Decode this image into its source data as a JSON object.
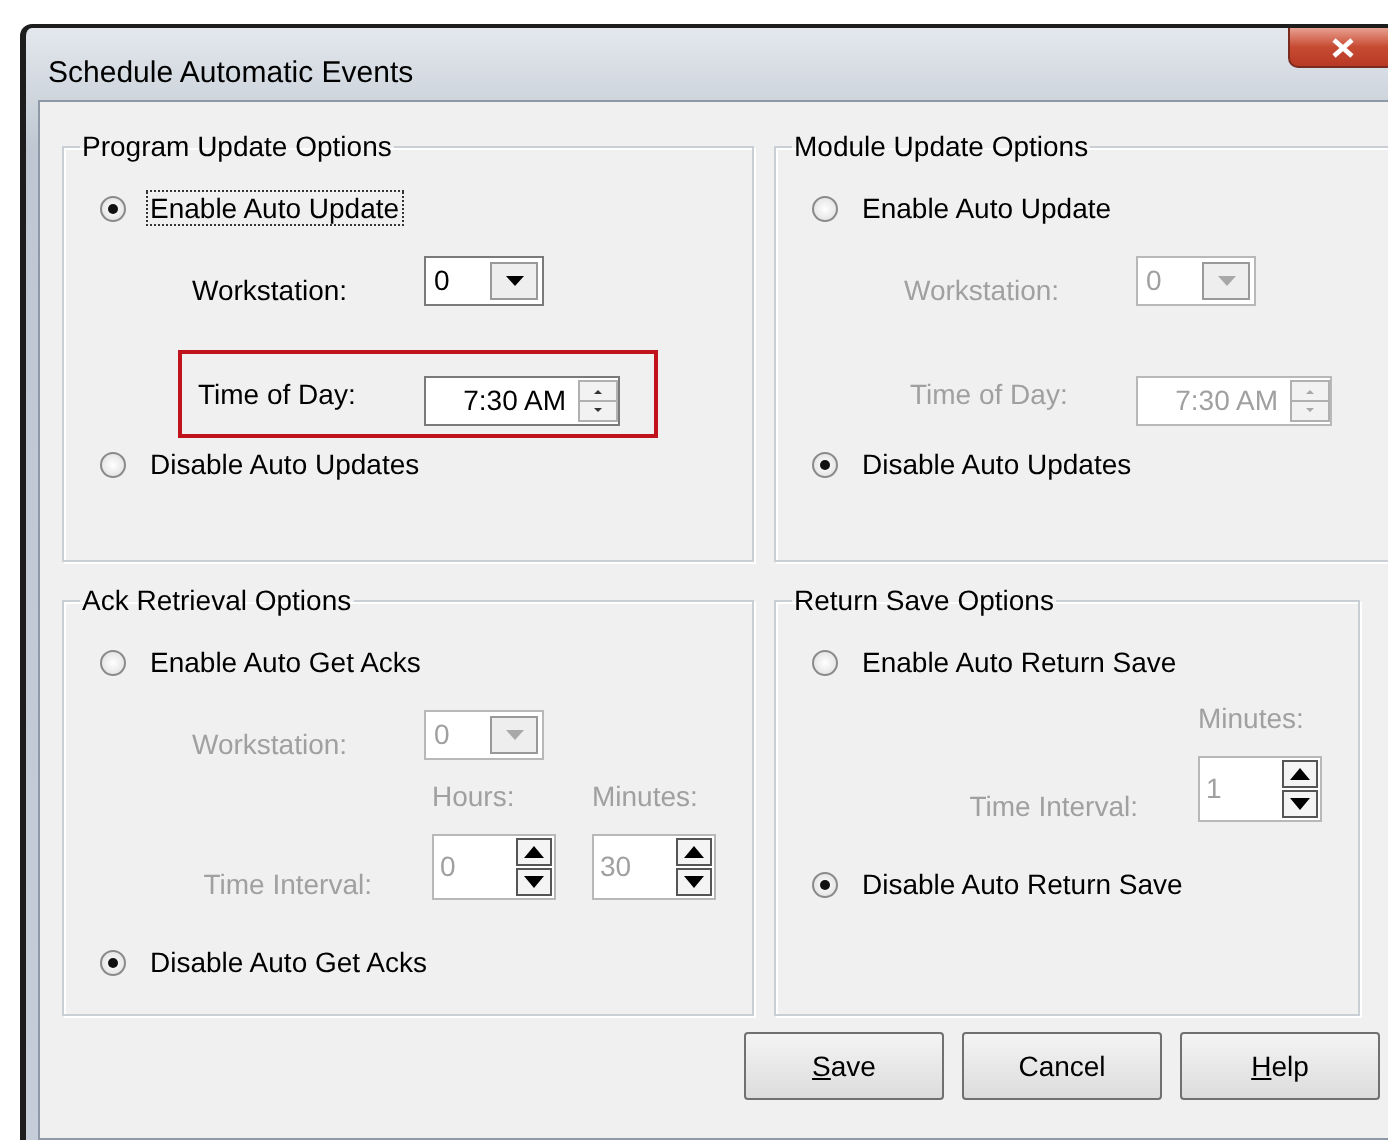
{
  "window": {
    "title": "Schedule Automatic Events"
  },
  "groups": [
    {
      "title": "Program Update Options",
      "rows": [
        {
          "kind": "radio",
          "label": "Enable Auto Update",
          "selected": true,
          "focused": true
        },
        {
          "kind": "dropdown",
          "label": "Workstation:",
          "value": "0",
          "disabled": false
        },
        {
          "kind": "time",
          "label": "Time of Day:",
          "value": "7:30 AM",
          "disabled": false,
          "highlighted": true
        },
        {
          "kind": "radio",
          "label": "Disable Auto Updates",
          "selected": false,
          "focused": false
        }
      ]
    },
    {
      "title": "Module Update Options",
      "rows": [
        {
          "kind": "radio",
          "label": "Enable Auto Update",
          "selected": false,
          "focused": false
        },
        {
          "kind": "dropdown",
          "label": "Workstation:",
          "value": "0",
          "disabled": true
        },
        {
          "kind": "time",
          "label": "Time of Day:",
          "value": "7:30 AM",
          "disabled": true,
          "highlighted": false
        },
        {
          "kind": "radio",
          "label": "Disable Auto Updates",
          "selected": true,
          "focused": false
        }
      ]
    },
    {
      "title": "Ack Retrieval Options",
      "rows": [
        {
          "kind": "radio",
          "label": "Enable Auto Get Acks",
          "selected": false,
          "focused": false
        },
        {
          "kind": "dropdown",
          "label": "Workstation:",
          "value": "0",
          "disabled": true
        },
        {
          "kind": "interval",
          "label": "Time Interval:",
          "disabled": true,
          "spinners": [
            {
              "header": "Hours:",
              "value": "0"
            },
            {
              "header": "Minutes:",
              "value": "30"
            }
          ]
        },
        {
          "kind": "radio",
          "label": "Disable Auto Get Acks",
          "selected": true,
          "focused": false
        }
      ]
    },
    {
      "title": "Return Save Options",
      "rows": [
        {
          "kind": "radio",
          "label": "Enable Auto Return Save",
          "selected": false,
          "focused": false
        },
        {
          "kind": "interval",
          "label": "Time Interval:",
          "disabled": true,
          "spinners": [
            {
              "header": "Minutes:",
              "value": "1"
            }
          ]
        },
        {
          "kind": "radio",
          "label": "Disable Auto Return Save",
          "selected": true,
          "focused": false
        }
      ]
    }
  ],
  "buttons": [
    {
      "label": "Save",
      "underline_first": true
    },
    {
      "label": "Cancel",
      "underline_first": false
    },
    {
      "label": "Help",
      "underline_first": true
    }
  ]
}
